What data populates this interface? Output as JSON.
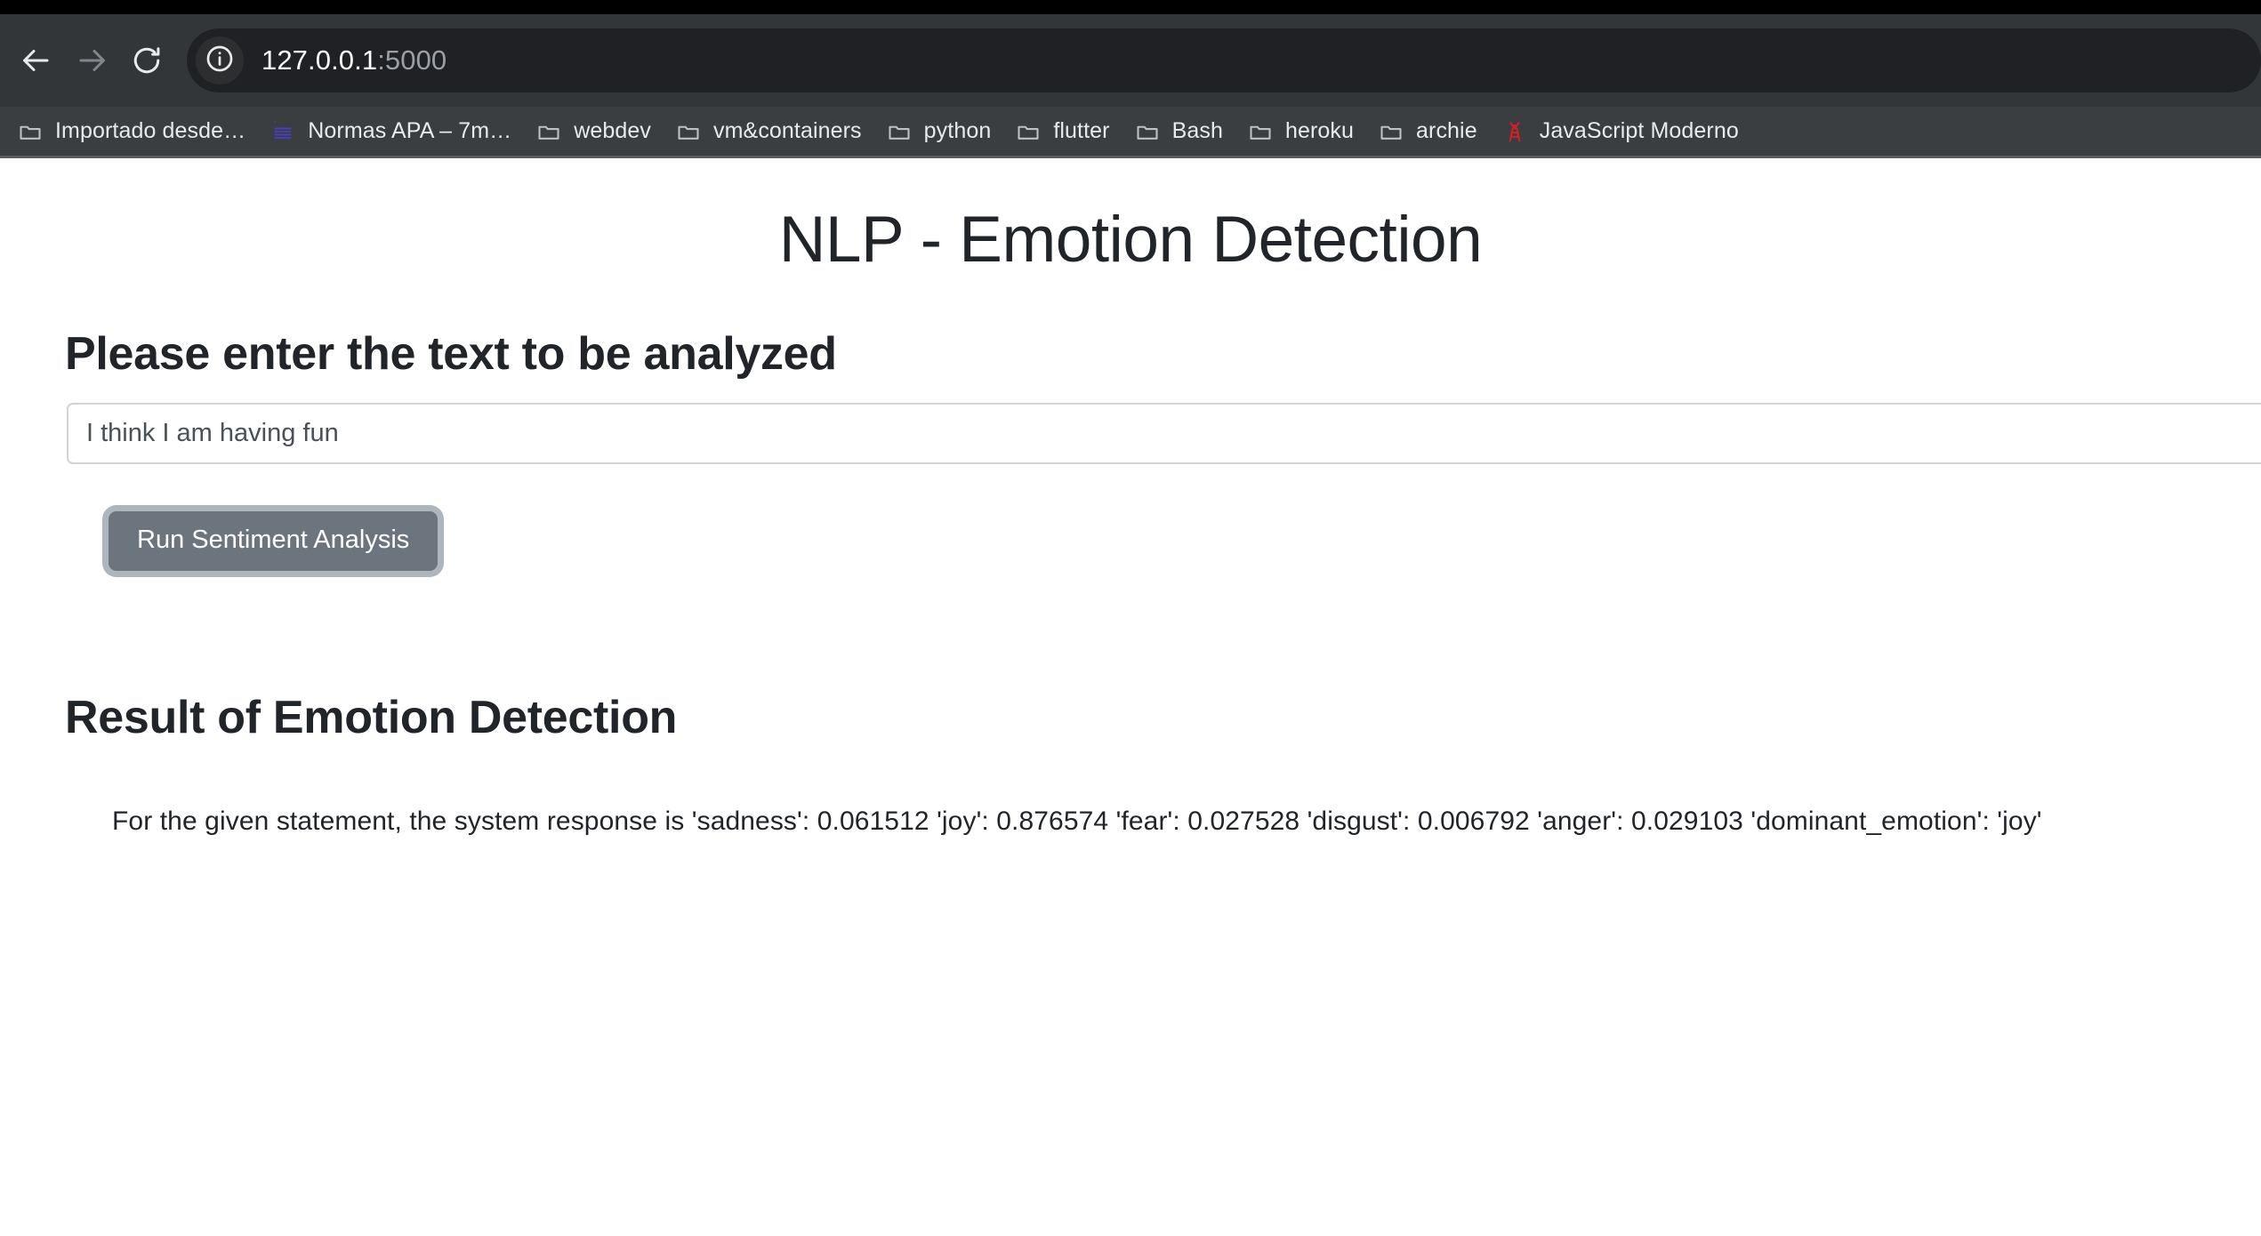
{
  "browser": {
    "nav": {
      "back_label": "Back",
      "forward_label": "Forward",
      "reload_label": "Reload"
    },
    "omnibox": {
      "site_info_label": "View site information",
      "url_host": "127.0.0.1",
      "url_port": ":5000",
      "full_url": "127.0.0.1:5000"
    },
    "bookmarks": [
      {
        "label": "Importado desde…",
        "icon": "folder-icon"
      },
      {
        "label": "Normas APA – 7m…",
        "icon": "quote-lines-icon"
      },
      {
        "label": "webdev",
        "icon": "folder-icon"
      },
      {
        "label": "vm&containers",
        "icon": "folder-icon"
      },
      {
        "label": "python",
        "icon": "folder-icon"
      },
      {
        "label": "flutter",
        "icon": "folder-icon"
      },
      {
        "label": "Bash",
        "icon": "folder-icon"
      },
      {
        "label": "heroku",
        "icon": "folder-icon"
      },
      {
        "label": "archie",
        "icon": "folder-icon"
      },
      {
        "label": "JavaScript Moderno",
        "icon": "red-tower-icon"
      }
    ]
  },
  "page": {
    "title": "NLP - Emotion Detection",
    "input_section": {
      "heading": "Please enter the text to be analyzed",
      "input_value": "I think I am having fun",
      "input_placeholder": "",
      "button_label": "Run Sentiment Analysis"
    },
    "result_section": {
      "heading": "Result of Emotion Detection",
      "text": "For the given statement, the system response is 'sadness': 0.061512 'joy': 0.876574 'fear': 0.027528 'disgust': 0.006792 'anger': 0.029103 'dominant_emotion': 'joy'"
    }
  },
  "emotions": {
    "sadness": 0.061512,
    "joy": 0.876574,
    "fear": 0.027528,
    "disgust": 0.006792,
    "anger": 0.029103,
    "dominant_emotion": "joy"
  },
  "colors": {
    "chrome_bg": "#323639",
    "bookmarks_bg": "#3b3e40",
    "omnibox_bg": "#202124",
    "button_bg": "#6c757d",
    "button_focus_ring": "#adb5bd",
    "text_dark": "#212529",
    "input_border": "#ced4da"
  }
}
